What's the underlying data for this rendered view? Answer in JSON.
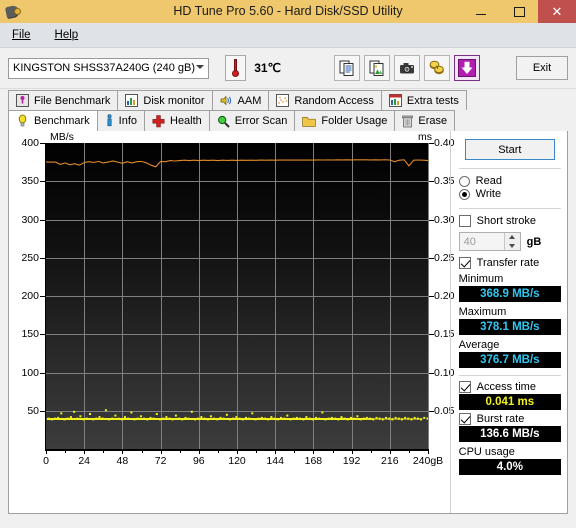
{
  "window": {
    "title": "HD Tune Pro 5.60 - Hard Disk/SSD Utility",
    "icon": "hdd-icon",
    "minimize_label": "–",
    "maximize_label": "□",
    "close_label": "✕",
    "titlebar_color": "#efc76c",
    "close_color": "#c0504d"
  },
  "menu": {
    "items": [
      {
        "label": "File",
        "accel": "F"
      },
      {
        "label": "Help",
        "accel": "H"
      }
    ]
  },
  "toolbar": {
    "drive": "KINGSTON SHSS37A240G (240 gB)",
    "drive_dropdown_icon": "chevron-down-icon",
    "temperature_icon": "thermometer-icon",
    "temperature": "31℃",
    "buttons": [
      {
        "name": "copy-text-button",
        "icon": "copy-text-icon",
        "tooltip": "Copy text"
      },
      {
        "name": "copy-image-button",
        "icon": "copy-image-icon",
        "tooltip": "Copy image"
      },
      {
        "name": "screenshot-button",
        "icon": "camera-icon",
        "tooltip": "Screenshot"
      },
      {
        "name": "options-button",
        "icon": "coins-icon",
        "tooltip": "Options"
      },
      {
        "name": "save-button",
        "icon": "download-arrow-icon",
        "tooltip": "Save"
      }
    ],
    "exit_label": "Exit"
  },
  "tabs": {
    "row1": [
      {
        "label": "File Benchmark",
        "icon": "file-benchmark-icon",
        "active": false
      },
      {
        "label": "Disk monitor",
        "icon": "bar-chart-icon",
        "active": false
      },
      {
        "label": "AAM",
        "icon": "speaker-icon",
        "active": false
      },
      {
        "label": "Random Access",
        "icon": "scatter-icon",
        "active": false
      },
      {
        "label": "Extra tests",
        "icon": "chart-icon",
        "active": false
      }
    ],
    "row2": [
      {
        "label": "Benchmark",
        "icon": "bulb-icon",
        "active": true
      },
      {
        "label": "Info",
        "icon": "info-icon",
        "active": false
      },
      {
        "label": "Health",
        "icon": "health-cross-icon",
        "active": false
      },
      {
        "label": "Error Scan",
        "icon": "magnifier-icon",
        "active": false
      },
      {
        "label": "Folder Usage",
        "icon": "folder-icon",
        "active": false
      },
      {
        "label": "Erase",
        "icon": "trash-icon",
        "active": false
      }
    ]
  },
  "panel": {
    "start_label": "Start",
    "mode_read_label": "Read",
    "mode_write_label": "Write",
    "mode_selected": "Write",
    "short_stroke_label": "Short stroke",
    "short_stroke_checked": false,
    "short_stroke_value": "40",
    "short_stroke_unit": "gB",
    "transfer_rate_label": "Transfer rate",
    "transfer_rate_checked": true,
    "minimum_label": "Minimum",
    "minimum_value": "368.9 MB/s",
    "maximum_label": "Maximum",
    "maximum_value": "378.1 MB/s",
    "average_label": "Average",
    "average_value": "376.7 MB/s",
    "access_time_label": "Access time",
    "access_time_checked": true,
    "access_time_value": "0.041 ms",
    "burst_rate_label": "Burst rate",
    "burst_rate_checked": true,
    "burst_rate_value": "136.6 MB/s",
    "cpu_usage_label": "CPU usage",
    "cpu_usage_value": "4.0%",
    "lcd_cyan": "#30c8f0",
    "lcd_yellow": "#f2f21e",
    "lcd_white": "#ffffff"
  },
  "chart_data": {
    "type": "line",
    "title": "",
    "xlabel": "240gB",
    "ylabel": "MB/s",
    "y2label": "ms",
    "xlim": [
      0,
      240
    ],
    "ylim": [
      0,
      400
    ],
    "y2lim": [
      0,
      0.4
    ],
    "grid": true,
    "legend": "none",
    "background": "#000000",
    "xticks": [
      0,
      24,
      48,
      72,
      96,
      120,
      144,
      168,
      192,
      216,
      240
    ],
    "xticklabels": [
      "0",
      "24",
      "48",
      "72",
      "96",
      "120",
      "144",
      "168",
      "192",
      "216",
      "240gB"
    ],
    "yticks": [
      0,
      50,
      100,
      150,
      200,
      250,
      300,
      350,
      400
    ],
    "yticklabels": [
      "0",
      "50",
      "100",
      "150",
      "200",
      "250",
      "300",
      "350",
      "400"
    ],
    "y2ticks": [
      0.05,
      0.1,
      0.15,
      0.2,
      0.25,
      0.3,
      0.35,
      0.4
    ],
    "y2ticklabels": [
      "0.05",
      "0.10",
      "0.15",
      "0.20",
      "0.25",
      "0.30",
      "0.35",
      "0.40"
    ],
    "series": [
      {
        "name": "Transfer rate",
        "type": "line",
        "color": "#e08a2a",
        "axis": "left",
        "unit": "MB/s",
        "x": [
          0,
          3,
          6,
          9,
          12,
          15,
          18,
          21,
          24,
          27,
          30,
          33,
          36,
          39,
          42,
          45,
          48,
          51,
          54,
          57,
          60,
          63,
          66,
          69,
          72,
          75,
          78,
          81,
          84,
          87,
          90,
          93,
          96,
          99,
          102,
          105,
          108,
          111,
          114,
          117,
          120,
          123,
          126,
          129,
          132,
          135,
          138,
          141,
          144,
          147,
          150,
          153,
          156,
          159,
          162,
          165,
          168,
          171,
          174,
          177,
          180,
          183,
          186,
          189,
          192,
          195,
          198,
          201,
          204,
          207,
          210,
          213,
          216,
          219,
          222,
          225,
          228,
          231,
          234,
          237,
          240
        ],
        "y": [
          375.0,
          375.2,
          375.0,
          372.0,
          374.0,
          371.5,
          373.0,
          371.0,
          374.5,
          375.5,
          374.5,
          376.0,
          374.0,
          375.0,
          376.5,
          375.0,
          373.5,
          375.5,
          374.0,
          375.5,
          376.0,
          374.0,
          371.0,
          368.9,
          376.0,
          375.5,
          377.0,
          376.5,
          377.0,
          377.5,
          377.0,
          377.5,
          377.0,
          377.5,
          377.2,
          377.5,
          377.0,
          377.5,
          377.3,
          377.5,
          377.2,
          377.5,
          377.4,
          377.5,
          377.4,
          377.6,
          377.5,
          377.6,
          377.5,
          377.7,
          377.6,
          377.7,
          377.6,
          377.8,
          377.7,
          377.8,
          377.7,
          377.9,
          377.8,
          377.9,
          377.8,
          378.0,
          377.9,
          378.0,
          377.9,
          378.1,
          378.0,
          378.0,
          377.9,
          378.0,
          377.9,
          378.0,
          377.8,
          375.5,
          377.5,
          378.0,
          370.0,
          377.5,
          377.8,
          377.5,
          377.0
        ]
      },
      {
        "name": "Access time",
        "type": "scatter",
        "color": "#f2f21e",
        "axis": "right",
        "unit": "ms",
        "x": [
          1,
          3,
          5,
          7,
          9,
          11,
          13,
          15,
          17,
          19,
          21,
          23,
          25,
          27,
          29,
          31,
          33,
          35,
          37,
          39,
          41,
          43,
          45,
          47,
          49,
          51,
          53,
          55,
          57,
          59,
          61,
          63,
          65,
          67,
          69,
          71,
          73,
          75,
          77,
          79,
          81,
          83,
          85,
          87,
          89,
          91,
          93,
          95,
          97,
          99,
          101,
          103,
          105,
          107,
          109,
          111,
          113,
          115,
          117,
          119,
          121,
          123,
          125,
          127,
          129,
          131,
          133,
          135,
          137,
          139,
          141,
          143,
          145,
          147,
          149,
          151,
          153,
          155,
          157,
          159,
          161,
          163,
          165,
          167,
          169,
          171,
          173,
          175,
          177,
          179,
          181,
          183,
          185,
          187,
          189,
          191,
          193,
          195,
          197,
          199,
          201,
          203,
          205,
          207,
          209,
          211,
          213,
          215,
          217,
          219,
          221,
          223,
          225,
          227,
          229,
          231,
          233,
          235,
          237,
          239
        ],
        "y": [
          0.041,
          0.04,
          0.041,
          0.042,
          0.048,
          0.04,
          0.041,
          0.043,
          0.05,
          0.041,
          0.044,
          0.04,
          0.041,
          0.047,
          0.04,
          0.041,
          0.043,
          0.041,
          0.052,
          0.04,
          0.041,
          0.045,
          0.041,
          0.04,
          0.043,
          0.041,
          0.049,
          0.04,
          0.041,
          0.044,
          0.041,
          0.04,
          0.042,
          0.041,
          0.047,
          0.04,
          0.041,
          0.043,
          0.041,
          0.04,
          0.045,
          0.041,
          0.04,
          0.042,
          0.041,
          0.05,
          0.04,
          0.041,
          0.043,
          0.041,
          0.04,
          0.044,
          0.041,
          0.04,
          0.042,
          0.041,
          0.046,
          0.04,
          0.041,
          0.043,
          0.041,
          0.04,
          0.042,
          0.041,
          0.048,
          0.04,
          0.041,
          0.042,
          0.041,
          0.04,
          0.043,
          0.041,
          0.04,
          0.042,
          0.041,
          0.045,
          0.04,
          0.041,
          0.042,
          0.041,
          0.04,
          0.043,
          0.041,
          0.04,
          0.042,
          0.041,
          0.049,
          0.04,
          0.041,
          0.042,
          0.041,
          0.04,
          0.043,
          0.041,
          0.04,
          0.042,
          0.041,
          0.044,
          0.04,
          0.041,
          0.042,
          0.041,
          0.04,
          0.042,
          0.041,
          0.04,
          0.042,
          0.041,
          0.04,
          0.042,
          0.041,
          0.04,
          0.042,
          0.041,
          0.04,
          0.042,
          0.041,
          0.04,
          0.042,
          0.041
        ]
      }
    ],
    "summary": {
      "minimum_mbs": 368.9,
      "maximum_mbs": 378.1,
      "average_mbs": 376.7,
      "access_time_ms": 0.041,
      "burst_rate_mbs": 136.6,
      "cpu_usage_pct": 4.0
    }
  }
}
